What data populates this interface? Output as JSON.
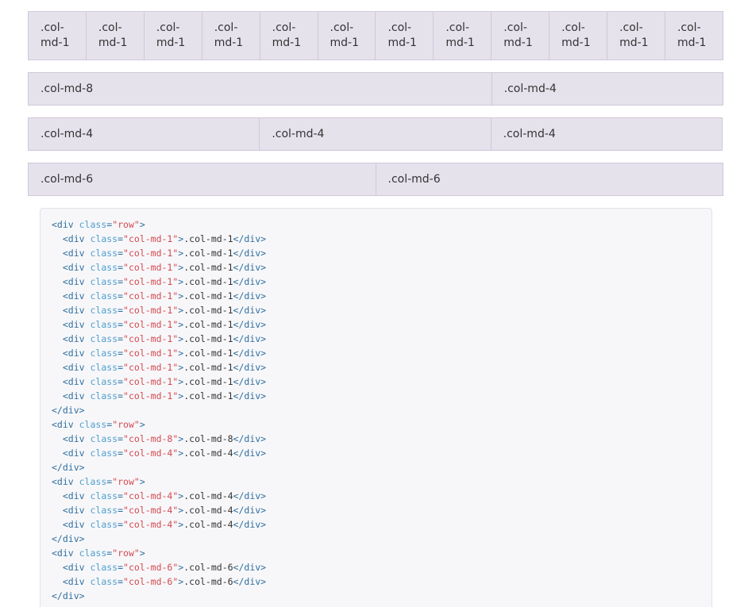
{
  "grid": {
    "row1": [
      ".col-md-1",
      ".col-md-1",
      ".col-md-1",
      ".col-md-1",
      ".col-md-1",
      ".col-md-1",
      ".col-md-1",
      ".col-md-1",
      ".col-md-1",
      ".col-md-1",
      ".col-md-1",
      ".col-md-1"
    ],
    "row2": [
      ".col-md-8",
      ".col-md-4"
    ],
    "row3": [
      ".col-md-4",
      ".col-md-4",
      ".col-md-4"
    ],
    "row4": [
      ".col-md-6",
      ".col-md-6"
    ]
  },
  "code": {
    "lines": [
      {
        "indent": "",
        "type": "open-row",
        "cls": "row"
      },
      {
        "indent": "  ",
        "type": "div",
        "cls": "col-md-1",
        "text": ".col-md-1"
      },
      {
        "indent": "  ",
        "type": "div",
        "cls": "col-md-1",
        "text": ".col-md-1"
      },
      {
        "indent": "  ",
        "type": "div",
        "cls": "col-md-1",
        "text": ".col-md-1"
      },
      {
        "indent": "  ",
        "type": "div",
        "cls": "col-md-1",
        "text": ".col-md-1"
      },
      {
        "indent": "  ",
        "type": "div",
        "cls": "col-md-1",
        "text": ".col-md-1"
      },
      {
        "indent": "  ",
        "type": "div",
        "cls": "col-md-1",
        "text": ".col-md-1"
      },
      {
        "indent": "  ",
        "type": "div",
        "cls": "col-md-1",
        "text": ".col-md-1"
      },
      {
        "indent": "  ",
        "type": "div",
        "cls": "col-md-1",
        "text": ".col-md-1"
      },
      {
        "indent": "  ",
        "type": "div",
        "cls": "col-md-1",
        "text": ".col-md-1"
      },
      {
        "indent": "  ",
        "type": "div",
        "cls": "col-md-1",
        "text": ".col-md-1"
      },
      {
        "indent": "  ",
        "type": "div",
        "cls": "col-md-1",
        "text": ".col-md-1"
      },
      {
        "indent": "  ",
        "type": "div",
        "cls": "col-md-1",
        "text": ".col-md-1"
      },
      {
        "indent": "",
        "type": "close-row"
      },
      {
        "indent": "",
        "type": "open-row",
        "cls": "row"
      },
      {
        "indent": "  ",
        "type": "div",
        "cls": "col-md-8",
        "text": ".col-md-8"
      },
      {
        "indent": "  ",
        "type": "div",
        "cls": "col-md-4",
        "text": ".col-md-4"
      },
      {
        "indent": "",
        "type": "close-row"
      },
      {
        "indent": "",
        "type": "open-row",
        "cls": "row"
      },
      {
        "indent": "  ",
        "type": "div",
        "cls": "col-md-4",
        "text": ".col-md-4"
      },
      {
        "indent": "  ",
        "type": "div",
        "cls": "col-md-4",
        "text": ".col-md-4"
      },
      {
        "indent": "  ",
        "type": "div",
        "cls": "col-md-4",
        "text": ".col-md-4"
      },
      {
        "indent": "",
        "type": "close-row"
      },
      {
        "indent": "",
        "type": "open-row",
        "cls": "row"
      },
      {
        "indent": "  ",
        "type": "div",
        "cls": "col-md-6",
        "text": ".col-md-6"
      },
      {
        "indent": "  ",
        "type": "div",
        "cls": "col-md-6",
        "text": ".col-md-6"
      },
      {
        "indent": "",
        "type": "close-row"
      }
    ]
  }
}
